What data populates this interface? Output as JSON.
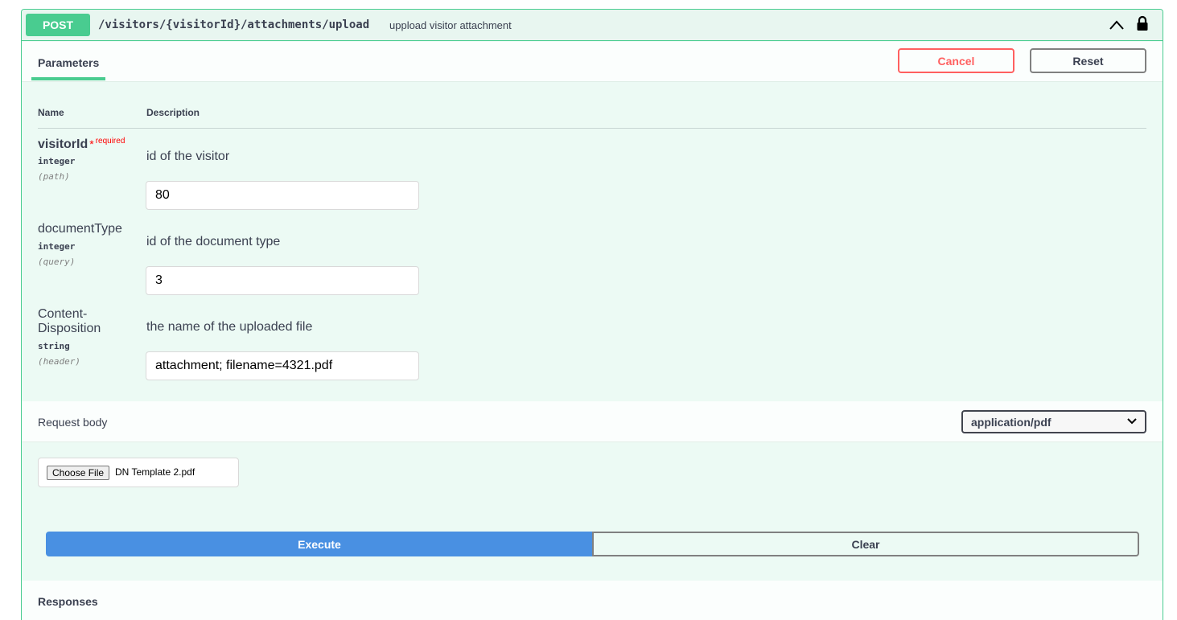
{
  "operation": {
    "method": "POST",
    "path": "/visitors/{visitorId}/attachments/upload",
    "summary": "uppload visitor attachment"
  },
  "tabs": {
    "parameters": "Parameters"
  },
  "actions": {
    "cancel": "Cancel",
    "reset": "Reset",
    "execute": "Execute",
    "clear": "Clear"
  },
  "columns": {
    "name": "Name",
    "description": "Description"
  },
  "parameters": [
    {
      "name": "visitorId",
      "required_star": "*",
      "required_text": "required",
      "type": "integer",
      "in": "(path)",
      "description": "id of the visitor",
      "value": "80"
    },
    {
      "name": "documentType",
      "type": "integer",
      "in": "(query)",
      "description": "id of the document type",
      "value": "3"
    },
    {
      "name_line1": "Content-",
      "name_line2": "Disposition",
      "type": "string",
      "in": "(header)",
      "description": "the name of the uploaded file",
      "value": "attachment; filename=4321.pdf"
    }
  ],
  "request_body": {
    "label": "Request body",
    "content_type": "application/pdf",
    "file_button": "Choose File",
    "file_name": "DN Template 2.pdf"
  },
  "responses": {
    "title": "Responses"
  },
  "colors": {
    "post": "#49cc90",
    "cancel": "#ff6060",
    "execute": "#4990e2"
  },
  "icons": [
    "chevron-up-icon",
    "lock-icon",
    "chevron-down-icon"
  ]
}
